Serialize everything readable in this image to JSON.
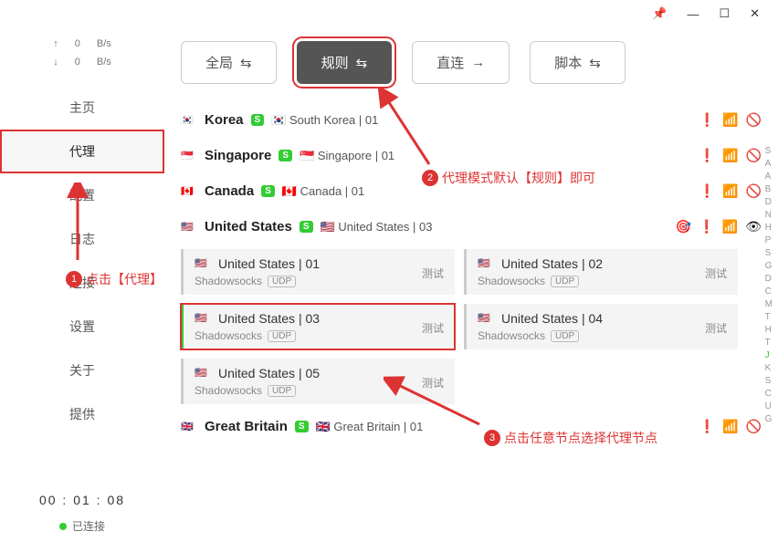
{
  "titlebar": {
    "pin": "📌",
    "min": "—",
    "max": "☐",
    "close": "✕"
  },
  "speed": {
    "up_arrow": "↑",
    "down_arrow": "↓",
    "up": "0",
    "down": "0",
    "unit": "B/s"
  },
  "nav": {
    "home": "主页",
    "proxy": "代理",
    "config": "配置",
    "log": "日志",
    "conn": "连接",
    "settings": "设置",
    "about": "关于",
    "provide": "提供"
  },
  "footer": {
    "timer": "00 : 01 : 08",
    "status": "已连接"
  },
  "tabs": {
    "global": "全局",
    "rule": "规则",
    "direct": "直连",
    "script": "脚本",
    "arr_shuffle": "⇆",
    "arr_right": "→"
  },
  "groups": [
    {
      "flag": "🇰🇷",
      "name": "Korea",
      "current": "🇰🇷 South Korea | 01"
    },
    {
      "flag": "🇸🇬",
      "name": "Singapore",
      "current": "🇸🇬 Singapore | 01"
    },
    {
      "flag": "🇨🇦",
      "name": "Canada",
      "current": "🇨🇦 Canada | 01"
    },
    {
      "flag": "🇺🇸",
      "name": "United States",
      "current": "🇺🇸 United States | 03",
      "extra_icon": true
    }
  ],
  "nodes": [
    {
      "flag": "🇺🇸",
      "title": "United States | 01",
      "proto": "Shadowsocks"
    },
    {
      "flag": "🇺🇸",
      "title": "United States | 02",
      "proto": "Shadowsocks"
    },
    {
      "flag": "🇺🇸",
      "title": "United States | 03",
      "proto": "Shadowsocks",
      "sel": true,
      "boxed": true
    },
    {
      "flag": "🇺🇸",
      "title": "United States | 04",
      "proto": "Shadowsocks"
    },
    {
      "flag": "🇺🇸",
      "title": "United States | 05",
      "proto": "Shadowsocks"
    }
  ],
  "node_meta": {
    "udp": "UDP",
    "test": "测试"
  },
  "gb": {
    "flag": "🇬🇧",
    "name": "Great Britain",
    "current": "🇬🇧 Great Britain | 01"
  },
  "icons": {
    "info": "❗",
    "wifi": "📶",
    "eye": "👁",
    "eyeoff": "🚫",
    "target": "🎯"
  },
  "alpha": [
    "S",
    "A",
    "A",
    "B",
    "D",
    "N",
    "H",
    "P",
    "S",
    "G",
    "D",
    "C",
    "M",
    "T",
    "H",
    "T",
    "J",
    "K",
    "S",
    "C",
    "U",
    "G"
  ],
  "annot": {
    "a1": "点击【代理】",
    "a2": "代理模式默认【规则】即可",
    "a3": "点击任意节点选择代理节点"
  }
}
